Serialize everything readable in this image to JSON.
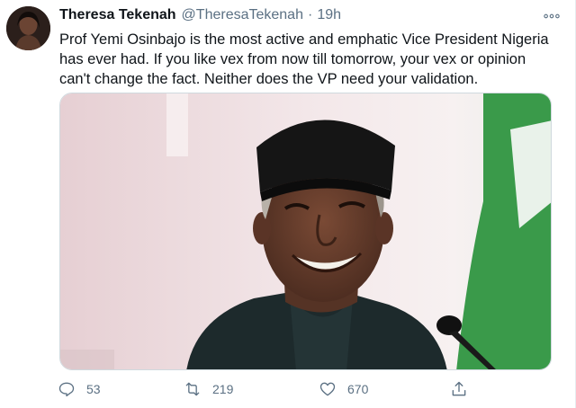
{
  "tweet": {
    "author_name": "Theresa Tekenah",
    "handle": "@TheresaTekenah",
    "separator": "·",
    "time": "19h",
    "text": "Prof Yemi Osinbajo is the most active and emphatic Vice President Nigeria\nhas ever had. If you like vex from now till tomorrow, your vex or opinion\ncan't change the fact. Neither does the VP need your validation.",
    "avatar_icon": "profile-photo",
    "more_icon": "more-horizontal-icon",
    "media": {
      "subject": "smiling man in black cap and dark attire",
      "background_colors": [
        "#e9d8da",
        "#3a9a4a",
        "#ffffff"
      ]
    }
  },
  "actions": {
    "reply": {
      "icon": "reply-icon",
      "count": "53"
    },
    "retweet": {
      "icon": "retweet-icon",
      "count": "219"
    },
    "like": {
      "icon": "heart-icon",
      "count": "670"
    },
    "share": {
      "icon": "share-icon"
    }
  },
  "colors": {
    "text_primary": "#0f1419",
    "text_secondary": "#5b7083",
    "border": "#cfd9de"
  }
}
